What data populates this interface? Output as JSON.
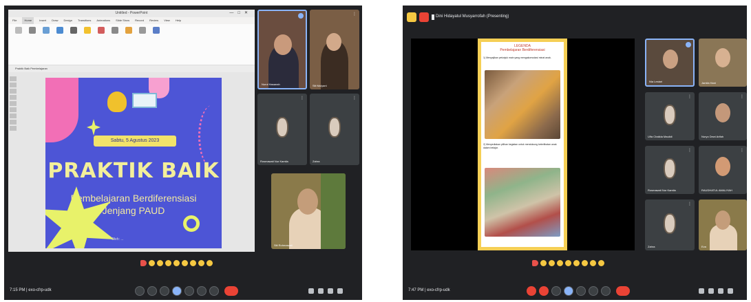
{
  "left_screenshot": {
    "ppt": {
      "window_title": "Untitled - PowerPoint",
      "tabs": [
        "File",
        "Home",
        "Insert",
        "Draw",
        "Design",
        "Transitions",
        "Animations",
        "Slide Show",
        "Record",
        "Review",
        "View",
        "Help"
      ],
      "active_tab": "Home",
      "doc_tab": "Praktik Baik Pembelajaran",
      "slide": {
        "date_line": "Sabtu, 5 Agustus 2023",
        "title": "PRAKTIK BAIK",
        "subtitle_line1": "Pembelajaran Berdiferensiasi",
        "subtitle_line2": "Jenjang PAUD",
        "footer": "Oleh: ..."
      }
    },
    "participants": [
      {
        "name": "Nurul Hasanah",
        "pinned": true
      },
      {
        "name": "Siti Mulyani",
        "pinned": false
      },
      {
        "name": "Rosmawati Nur Kamila",
        "pinned": false
      },
      {
        "name": "Zahra",
        "pinned": false
      },
      {
        "name": "Siti Rohmawati",
        "pinned": false
      }
    ],
    "clock": "7:15 PM | exo-cfrp-udk"
  },
  "right_screenshot": {
    "meeting_title": "Dini Hidayatul Musyarrofah (Presenting)",
    "doc": {
      "heading": "LEGENDA",
      "subheading": "Pembelajaran Berdiferensiasi",
      "para1": "1) Menyajikan petunjuk main yang mengakomodasi minat anak.",
      "para2": "2) Menyediakan pilihan kegiatan untuk mendukung keterlibatan anak dalam belajar."
    },
    "participants": [
      {
        "name": "Nia Lestari",
        "pinned": true
      },
      {
        "name": "Jamila Hani",
        "pinned": false
      },
      {
        "name": "Ulfa Chalida Maulidi",
        "pinned": false
      },
      {
        "name": "Nuryo Dewi Arifah",
        "pinned": false
      },
      {
        "name": "Rosmawati Nur Kamila",
        "pinned": false
      },
      {
        "name": "RAUDHATUL AMALIYAH",
        "pinned": false
      },
      {
        "name": "Zahra",
        "pinned": false
      },
      {
        "name": "Eva",
        "pinned": false
      }
    ],
    "clock": "7:47 PM | exo-cfrp-udk"
  },
  "colors": {
    "meet_bg": "#202124",
    "slide_bg": "#4d55d6",
    "accent_yellow": "#e8f26a",
    "accent_pink": "#f26fb6",
    "end_call": "#ea4335",
    "present_blue": "#8ab4f8"
  },
  "icons": [
    "mic-icon",
    "camera-icon",
    "captions-icon",
    "reaction-icon",
    "present-icon",
    "raise-hand-icon",
    "more-icon",
    "end-call-icon",
    "info-icon",
    "people-icon",
    "chat-icon",
    "activities-icon"
  ]
}
